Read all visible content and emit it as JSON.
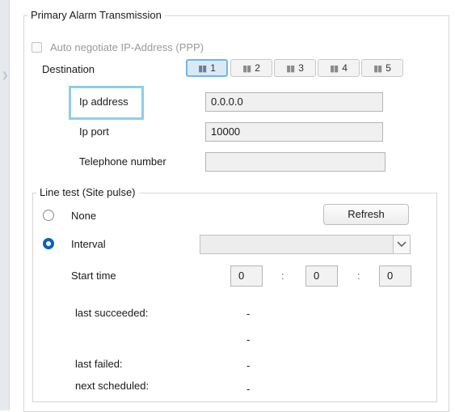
{
  "primary": {
    "title": "Primary Alarm Transmission",
    "auto_negotiate_label": "Auto negotiate IP-Address (PPP)",
    "destination_label": "Destination",
    "destinations": [
      {
        "label": "1",
        "active": true
      },
      {
        "label": "2",
        "active": false
      },
      {
        "label": "3",
        "active": false
      },
      {
        "label": "4",
        "active": false
      },
      {
        "label": "5",
        "active": false
      }
    ],
    "ip_address_label": "Ip address",
    "ip_address_value": "0.0.0.0",
    "ip_port_label": "Ip port",
    "ip_port_value": "10000",
    "telephone_label": "Telephone number",
    "telephone_value": ""
  },
  "line_test": {
    "title": "Line test (Site pulse)",
    "none_label": "None",
    "refresh_label": "Refresh",
    "interval_label": "Interval",
    "interval_value": "",
    "start_time_label": "Start time",
    "start_hour": "0",
    "start_minute": "0",
    "start_second": "0",
    "time_separator": ":",
    "last_succeeded_label": "last succeeded:",
    "last_succeeded_value": "-",
    "extra_value": "-",
    "last_failed_label": "last failed:",
    "last_failed_value": "-",
    "next_scheduled_label": "next scheduled:",
    "next_scheduled_value": "-"
  },
  "icons": {
    "tab": "signal-bars-icon",
    "dropdown": "chevron-down-icon"
  },
  "colors": {
    "accent": "#0a63b8",
    "highlight": "#8ccfea",
    "active_tab": "#dbe9f6"
  }
}
